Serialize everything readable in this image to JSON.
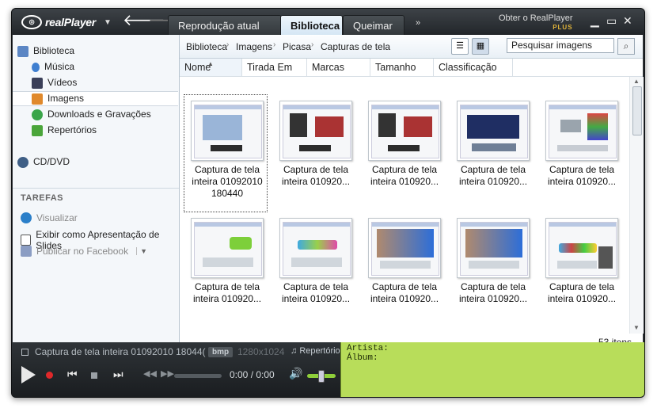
{
  "app": {
    "logo": "realPlayer",
    "tabs": [
      {
        "label": "Reprodução atual"
      },
      {
        "label": "Biblioteca"
      },
      {
        "label": "Queimar"
      }
    ],
    "get_plus": "Obter o RealPlayer",
    "get_plus_sub": "PLUS"
  },
  "sidebar": {
    "items": [
      {
        "label": "Biblioteca"
      },
      {
        "label": "Música"
      },
      {
        "label": "Vídeos"
      },
      {
        "label": "Imagens"
      },
      {
        "label": "Downloads e Gravações"
      },
      {
        "label": "Repertórios"
      },
      {
        "label": "CD/DVD"
      }
    ],
    "tasks_heading": "TAREFAS",
    "tasks": [
      {
        "label": "Visualizar"
      },
      {
        "label": "Exibir como Apresentação de Slides"
      },
      {
        "label": "Publicar no Facebook"
      }
    ]
  },
  "breadcrumb": [
    "Biblioteca",
    "Imagens",
    "Picasa",
    "Capturas de tela"
  ],
  "search": {
    "value": "Pesquisar imagens"
  },
  "columns": [
    "Nome",
    "Tirada Em",
    "Marcas",
    "Tamanho",
    "Classificação"
  ],
  "thumbnails": [
    {
      "caption_1": "Captura de tela",
      "caption_2": "inteira 01092010",
      "caption_3": "180440"
    },
    {
      "caption_1": "Captura de tela",
      "caption_2": "inteira 010920..."
    },
    {
      "caption_1": "Captura de tela",
      "caption_2": "inteira 010920..."
    },
    {
      "caption_1": "Captura de tela",
      "caption_2": "inteira 010920..."
    },
    {
      "caption_1": "Captura de tela",
      "caption_2": "inteira 010920..."
    },
    {
      "caption_1": "Captura de tela",
      "caption_2": "inteira 010920..."
    },
    {
      "caption_1": "Captura de tela",
      "caption_2": "inteira 010920..."
    },
    {
      "caption_1": "Captura de tela",
      "caption_2": "inteira 010920..."
    },
    {
      "caption_1": "Captura de tela",
      "caption_2": "inteira 010920..."
    },
    {
      "caption_1": "Captura de tela",
      "caption_2": "inteira 010920..."
    }
  ],
  "item_count": "53 itens",
  "player": {
    "now_playing": "Captura de tela inteira 01092010 18044(",
    "format": "bmp",
    "resolution": "1280x1024",
    "playlist": "Repertório",
    "time": "0:00 / 0:00",
    "artist_label": "Artista:",
    "album_label": "Álbum:"
  }
}
